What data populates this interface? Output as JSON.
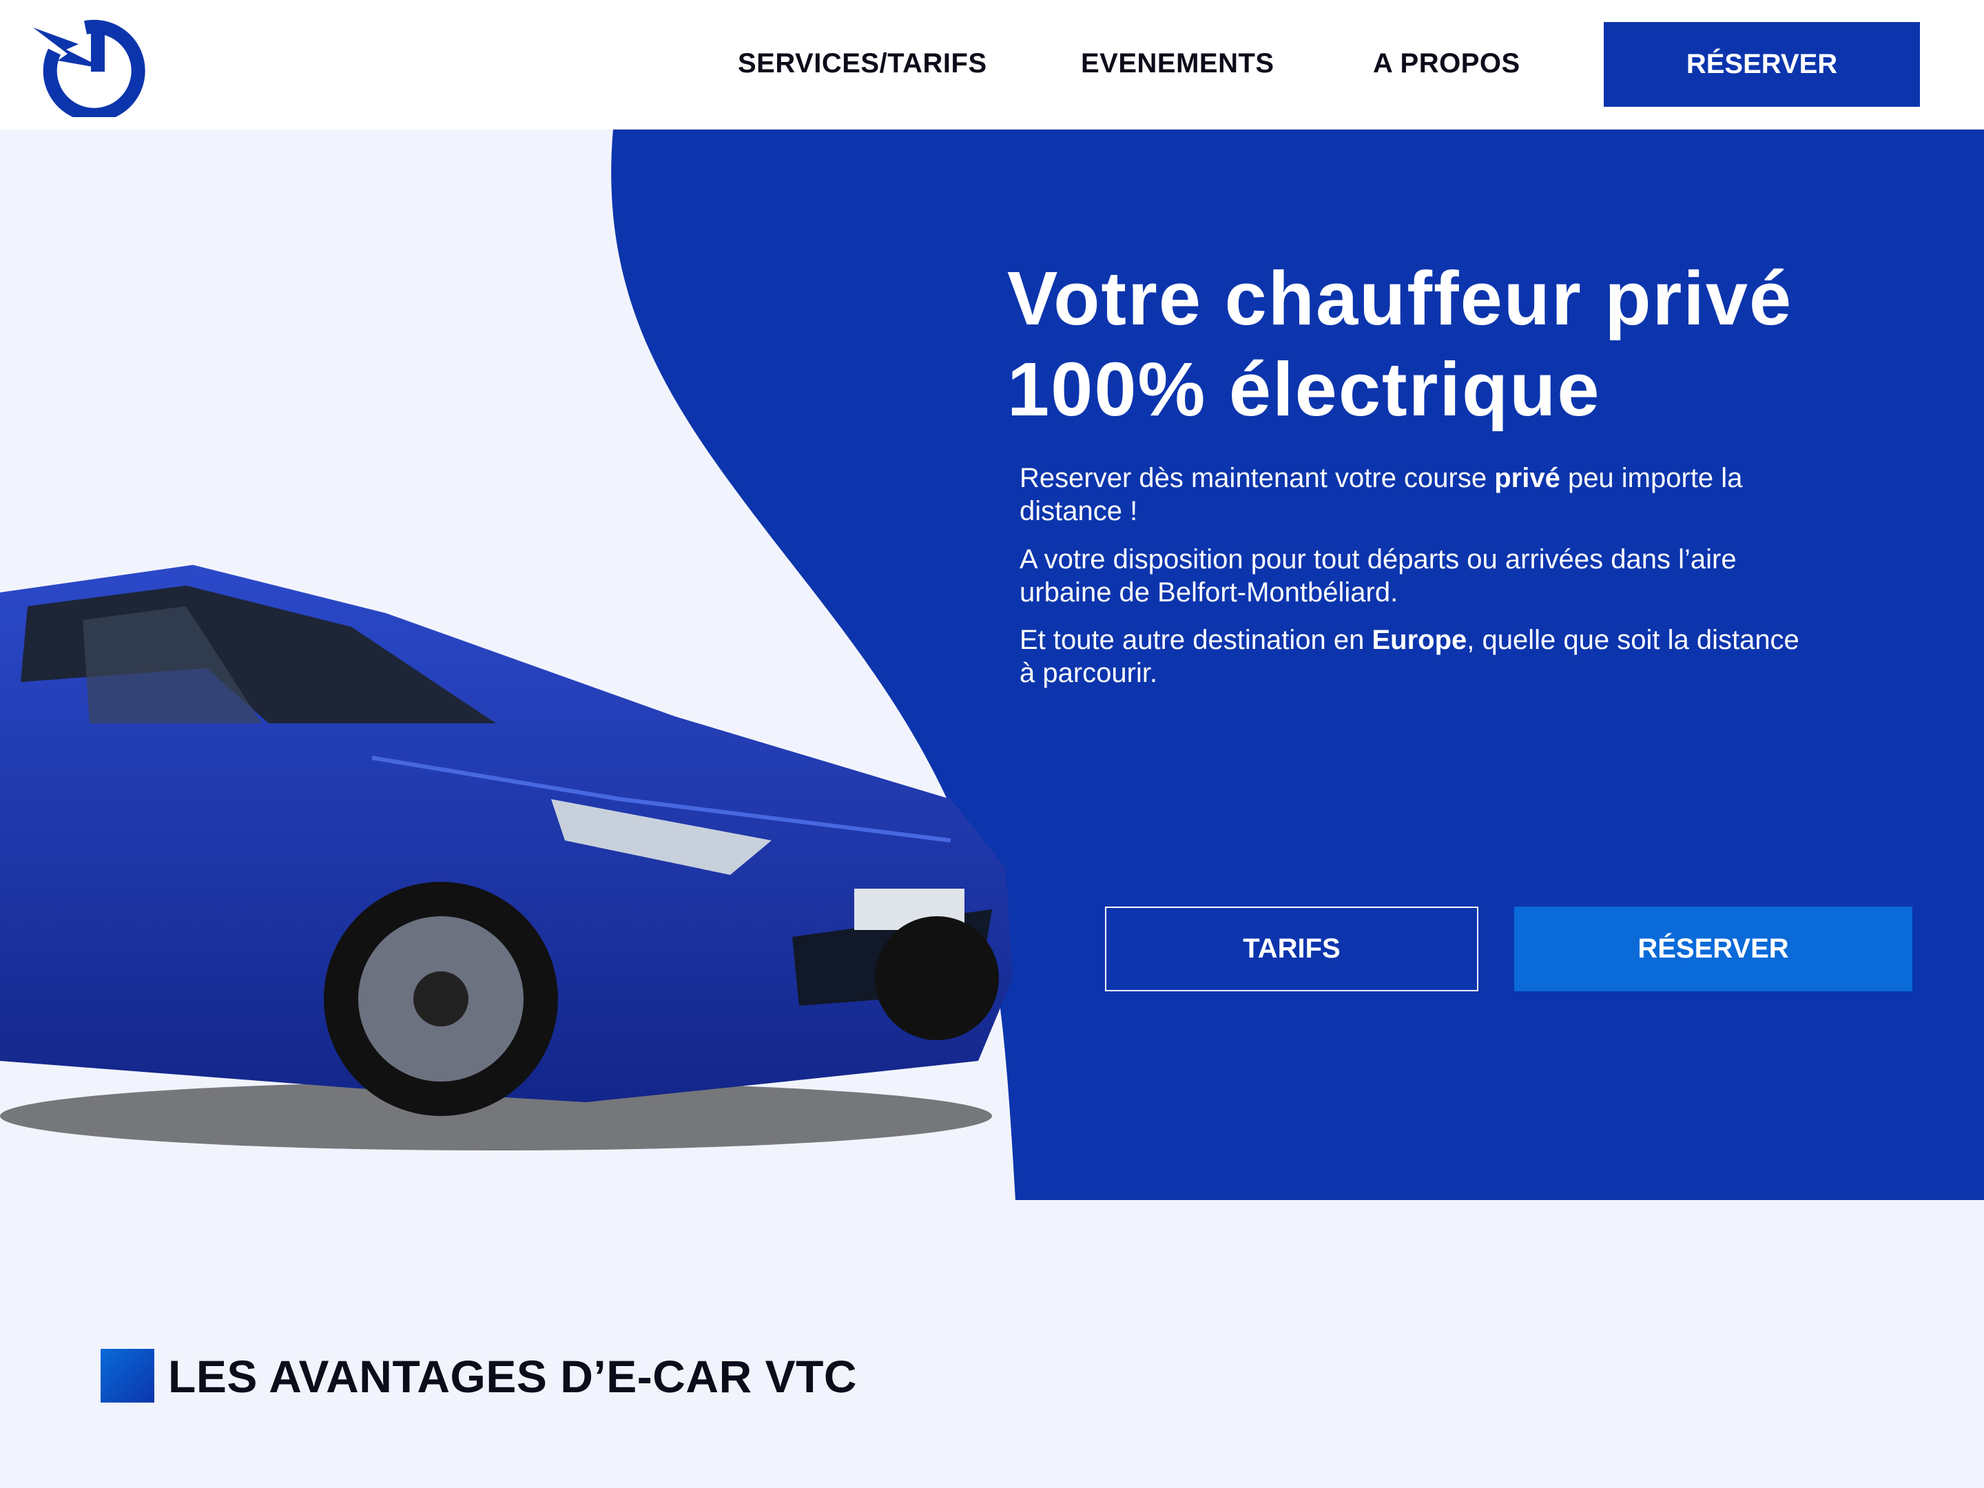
{
  "colors": {
    "primary": "#0c35ad",
    "accent": "#0a6ad8",
    "background": "#f2f4fd",
    "text": "#0c0c1a"
  },
  "header": {
    "logo_icon": "power-lightning-logo",
    "nav": {
      "services": "SERVICES/TARIFS",
      "events": "EVENEMENTS",
      "about": "A PROPOS"
    },
    "reserve_label": "RÉSERVER"
  },
  "hero": {
    "title_line1": "Votre chauffeur privé",
    "title_line2": "100% électrique",
    "p1": {
      "a": "Reserver dès maintenant votre course ",
      "b": "privé",
      "c": " peu importe la distance !"
    },
    "p2": "A votre disposition pour tout départs ou arrivées dans l’aire urbaine de Belfort-Montbéliard.",
    "p3": {
      "a": "Et toute autre destination en ",
      "b": "Europe",
      "c": ", quelle que soit la distance à parcourir."
    },
    "tarifs_label": "TARIFS",
    "reserve_label": "RÉSERVER",
    "image_icon": "electric-car-image"
  },
  "section": {
    "title": "LES AVANTAGES D’E-CAR VTC"
  }
}
